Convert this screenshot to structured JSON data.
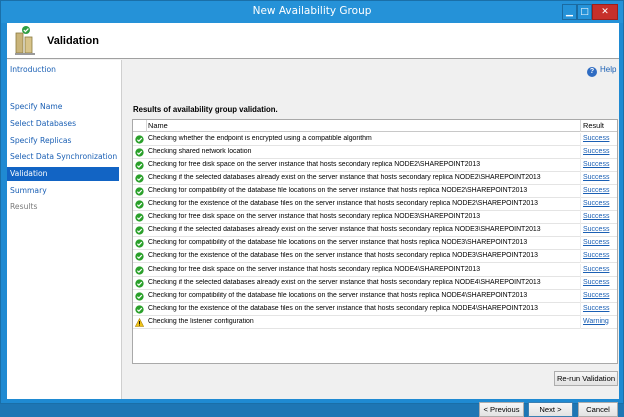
{
  "window": {
    "title": "New Availability Group",
    "controls": {
      "minimize": "▁",
      "maximize": "□",
      "close": "✕"
    }
  },
  "header": {
    "title": "Validation",
    "icon": "wizard-page-icon"
  },
  "nav": {
    "items": [
      {
        "label": "Introduction",
        "state": "link"
      },
      {
        "label": "Specify Name",
        "state": "link"
      },
      {
        "label": "Select Databases",
        "state": "link"
      },
      {
        "label": "Specify Replicas",
        "state": "link"
      },
      {
        "label": "Select Data Synchronization",
        "state": "link"
      },
      {
        "label": "Validation",
        "state": "active"
      },
      {
        "label": "Summary",
        "state": "link"
      },
      {
        "label": "Results",
        "state": "disabled"
      }
    ]
  },
  "help": {
    "label": "Help",
    "icon": "help-icon"
  },
  "main": {
    "section_label": "Results of availability group validation."
  },
  "grid": {
    "columns": {
      "name": "Name",
      "result": "Result"
    },
    "rows": [
      {
        "status": "success",
        "name": "Checking whether the endpoint is encrypted using a compatible algorithm",
        "result": "Success"
      },
      {
        "status": "success",
        "name": "Checking shared network location",
        "result": "Success"
      },
      {
        "status": "success",
        "name": "Checking for free disk space on the server instance that hosts secondary replica NODE2\\SHAREPOINT2013",
        "result": "Success"
      },
      {
        "status": "success",
        "name": "Checking if the selected databases already exist on the server instance that hosts secondary replica NODE2\\SHAREPOINT2013",
        "result": "Success"
      },
      {
        "status": "success",
        "name": "Checking for compatibility of the database file locations on the server instance that hosts replica NODE2\\SHAREPOINT2013",
        "result": "Success"
      },
      {
        "status": "success",
        "name": "Checking for the existence of the database files on the server instance that hosts secondary replica NODE2\\SHAREPOINT2013",
        "result": "Success"
      },
      {
        "status": "success",
        "name": "Checking for free disk space on the server instance that hosts secondary replica NODE3\\SHAREPOINT2013",
        "result": "Success"
      },
      {
        "status": "success",
        "name": "Checking if the selected databases already exist on the server instance that hosts secondary replica NODE3\\SHAREPOINT2013",
        "result": "Success"
      },
      {
        "status": "success",
        "name": "Checking for compatibility of the database file locations on the server instance that hosts replica NODE3\\SHAREPOINT2013",
        "result": "Success"
      },
      {
        "status": "success",
        "name": "Checking for the existence of the database files on the server instance that hosts secondary replica NODE3\\SHAREPOINT2013",
        "result": "Success"
      },
      {
        "status": "success",
        "name": "Checking for free disk space on the server instance that hosts secondary replica NODE4\\SHAREPOINT2013",
        "result": "Success"
      },
      {
        "status": "success",
        "name": "Checking if the selected databases already exist on the server instance that hosts secondary replica NODE4\\SHAREPOINT2013",
        "result": "Success"
      },
      {
        "status": "success",
        "name": "Checking for compatibility of the database file locations on the server instance that hosts replica NODE4\\SHAREPOINT2013",
        "result": "Success"
      },
      {
        "status": "success",
        "name": "Checking for the existence of the database files on the server instance that hosts secondary replica NODE4\\SHAREPOINT2013",
        "result": "Success"
      },
      {
        "status": "warning",
        "name": "Checking the listener configuration",
        "result": "Warning"
      }
    ]
  },
  "buttons": {
    "rerun": "Re-run Validation",
    "previous": "< Previous",
    "next": "Next >",
    "cancel": "Cancel"
  },
  "colors": {
    "titlebar": "#2592d8",
    "nav_active": "#1264c4",
    "link": "#1a5fb4",
    "success": "#2aa02a",
    "warning": "#f0c419"
  }
}
